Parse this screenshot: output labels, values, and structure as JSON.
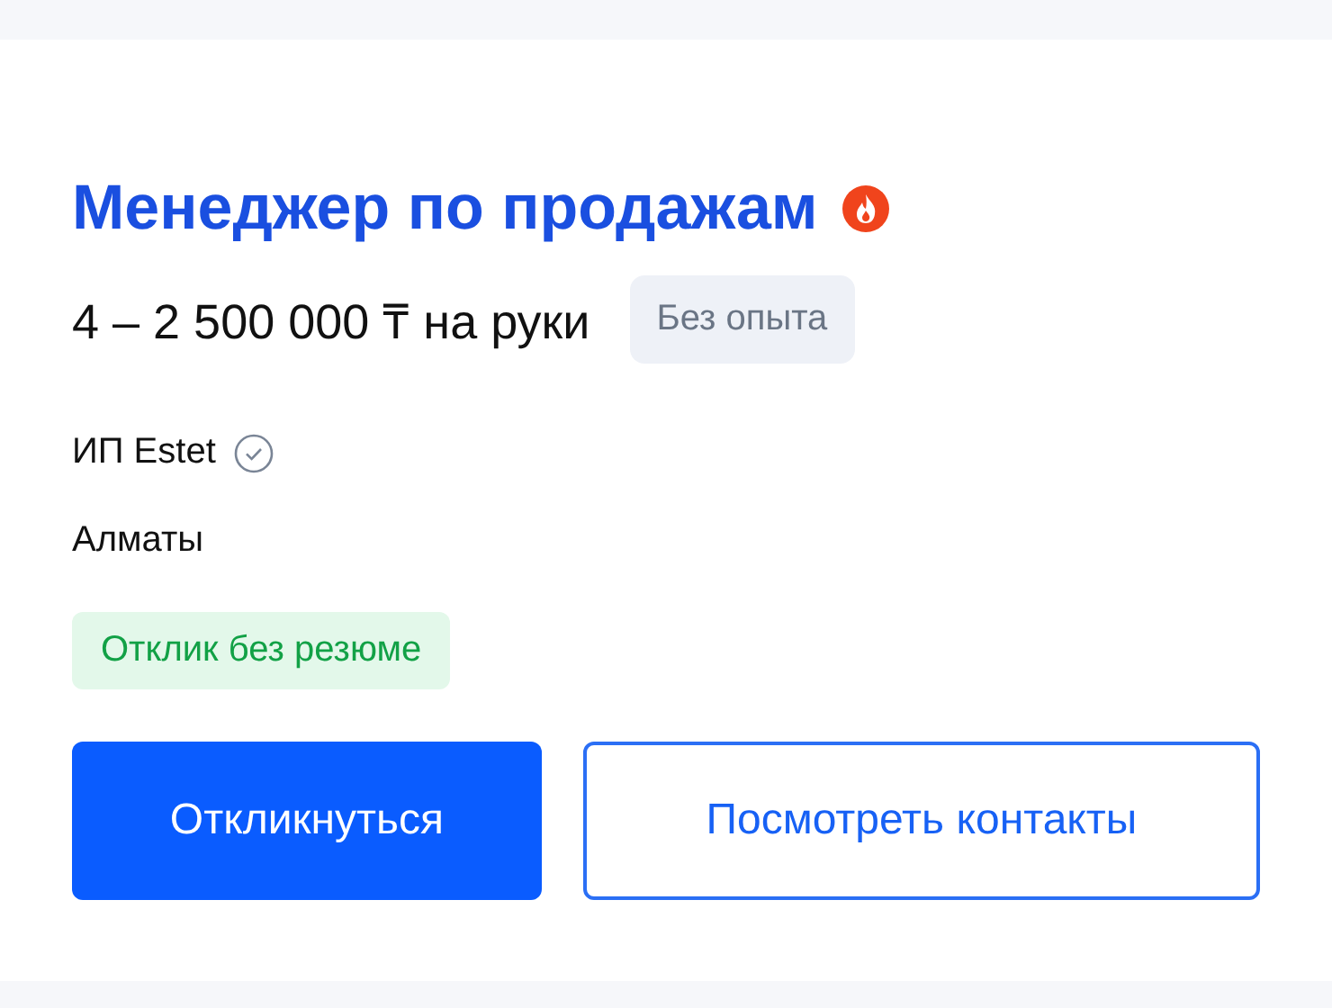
{
  "vacancy": {
    "title": "Менеджер по продажам",
    "hot": true,
    "salary": "4 – 2 500 000 ₸ на руки",
    "experience": "Без опыта",
    "company": "ИП Estet",
    "verified": true,
    "city": "Алматы",
    "tag": "Отклик без резюме"
  },
  "buttons": [
    {
      "label": "Откликнуться",
      "kind": "primary"
    },
    {
      "label": "Посмотреть контакты",
      "kind": "secondary"
    }
  ]
}
